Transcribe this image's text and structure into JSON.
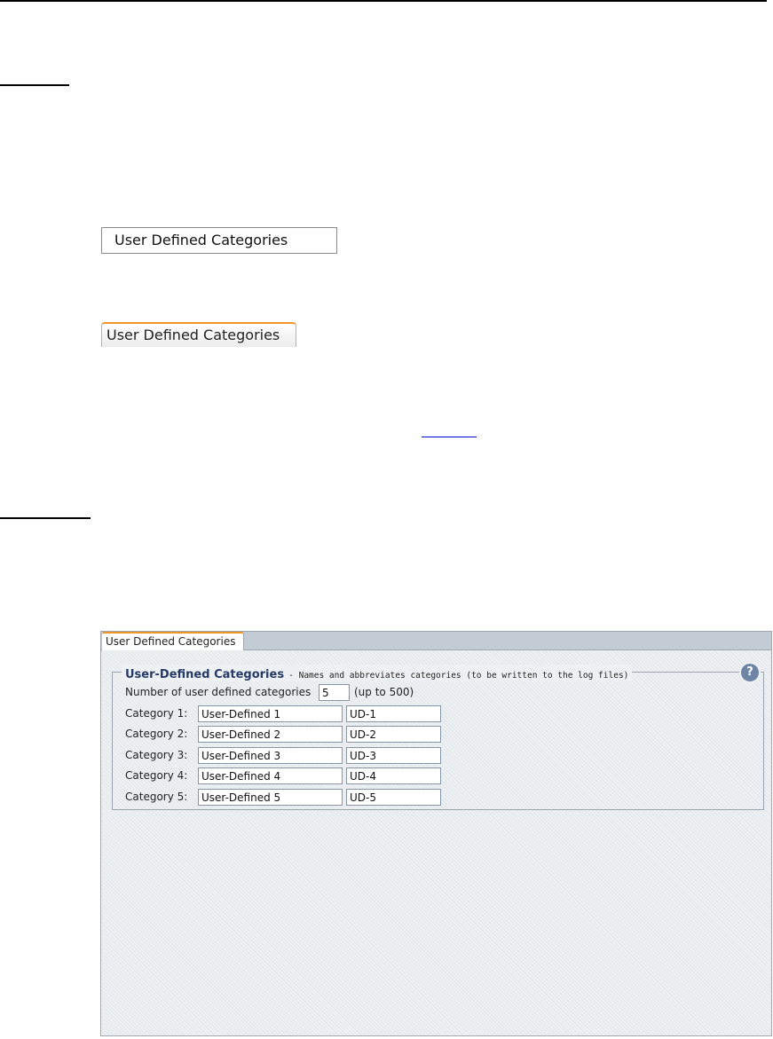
{
  "caption_box_label": "User Defined Categories",
  "caption_tab_label": "User Defined Categories",
  "panel": {
    "tab_label": "User Defined Categories",
    "legend_title": "User-Defined Categories",
    "legend_desc": "- Names and abbreviates categories (to be written to the log files)",
    "help_glyph": "?",
    "count_label": "Number of user defined categories",
    "count_value": "5",
    "count_hint": "(up to 500)",
    "categories": [
      {
        "label": "Category 1:",
        "name": "User-Defined 1",
        "abbr": "UD-1"
      },
      {
        "label": "Category 2:",
        "name": "User-Defined 2",
        "abbr": "UD-2"
      },
      {
        "label": "Category 3:",
        "name": "User-Defined 3",
        "abbr": "UD-3"
      },
      {
        "label": "Category 4:",
        "name": "User-Defined 4",
        "abbr": "UD-4"
      },
      {
        "label": "Category 5:",
        "name": "User-Defined 5",
        "abbr": "UD-5"
      }
    ]
  },
  "colors": {
    "accent_tab": "#f0952a",
    "legend_title": "#253a66",
    "help_icon": "#6e85a6"
  },
  "icons": {
    "help": "help-icon"
  }
}
